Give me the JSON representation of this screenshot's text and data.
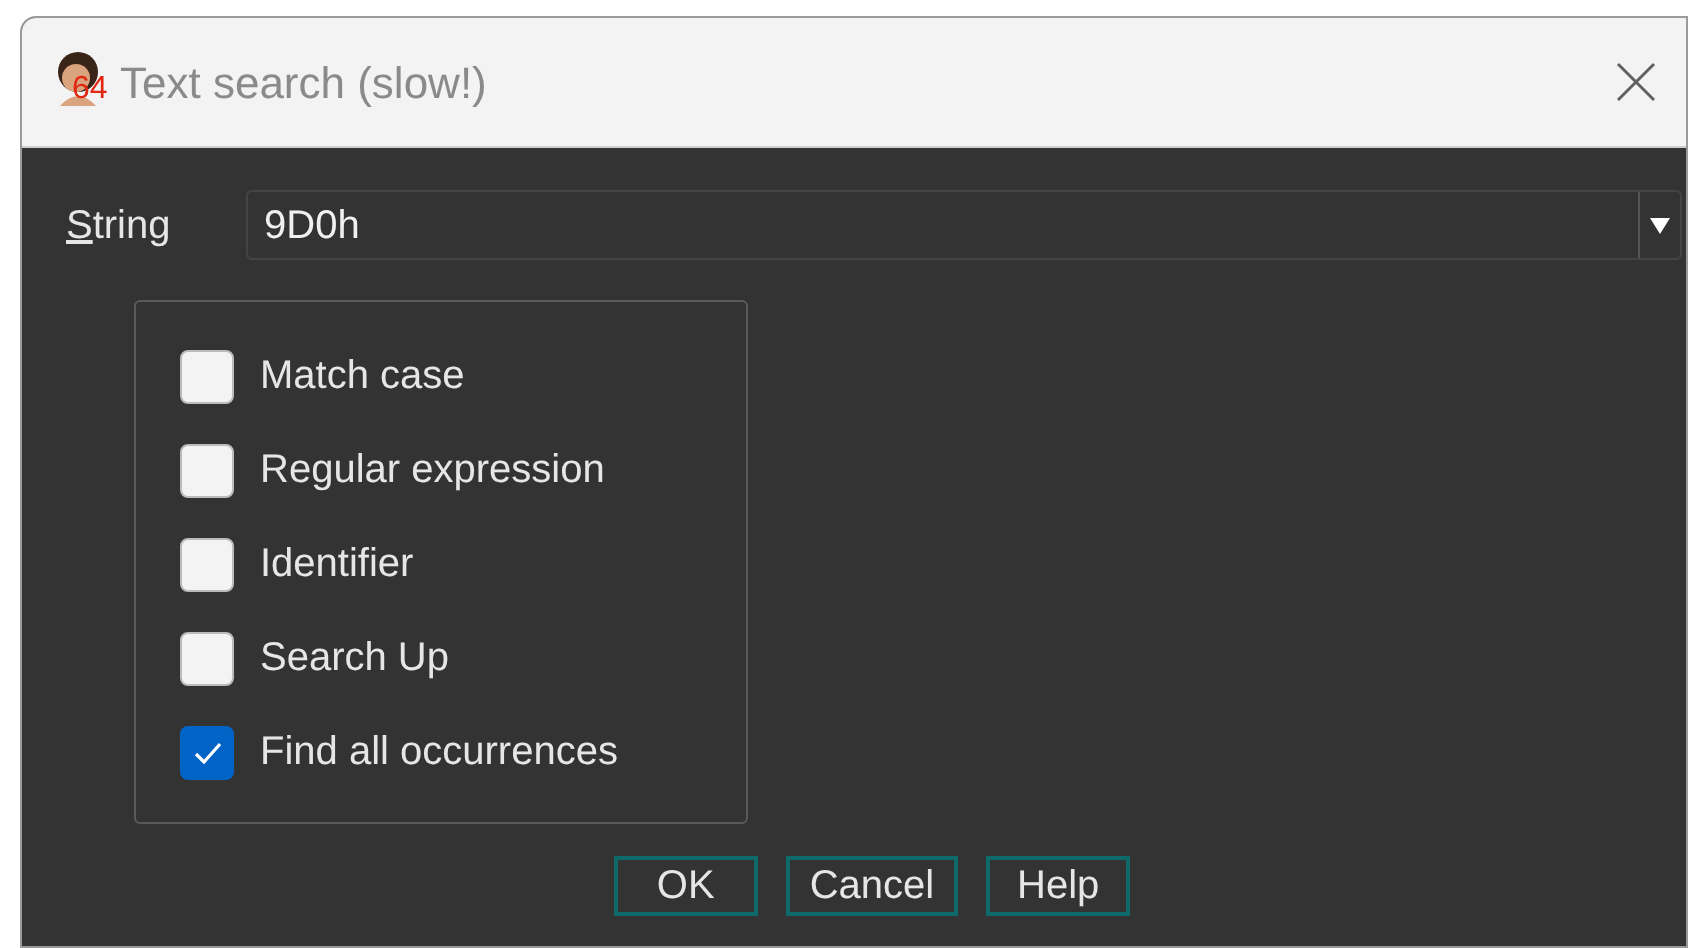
{
  "window": {
    "title": "Text search (slow!)",
    "icon_badge": "64"
  },
  "string_field": {
    "label": "String",
    "value": "9D0h"
  },
  "options": [
    {
      "label": "Match case",
      "checked": false
    },
    {
      "label": "Regular expression",
      "checked": false
    },
    {
      "label": "Identifier",
      "checked": false
    },
    {
      "label": "Search Up",
      "checked": false
    },
    {
      "label": "Find all occurrences",
      "checked": true
    }
  ],
  "buttons": [
    "OK",
    "Cancel",
    "Help"
  ]
}
